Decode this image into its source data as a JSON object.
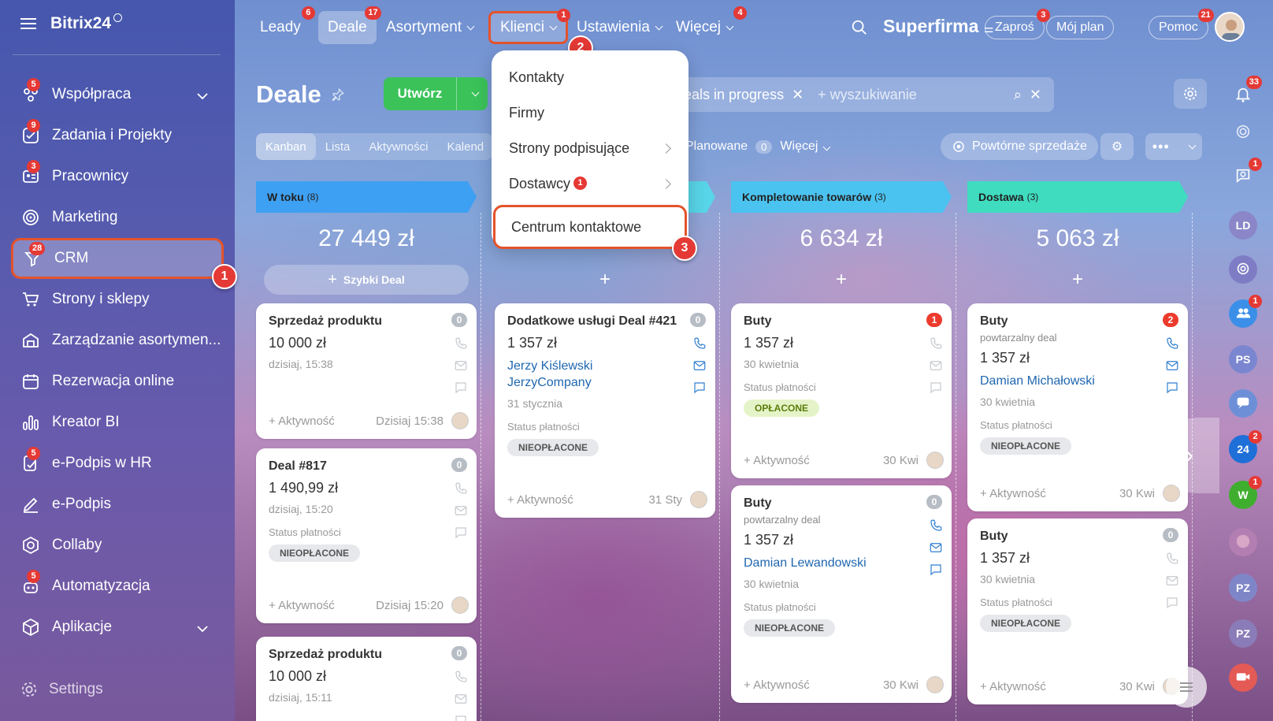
{
  "brand": {
    "name": "Bitrix24"
  },
  "sidebar": {
    "items": [
      {
        "label": "Współpraca",
        "badge": "5",
        "icon": "collab-icon",
        "chevron": true
      },
      {
        "label": "Zadania i Projekty",
        "badge": "9",
        "icon": "task-icon"
      },
      {
        "label": "Pracownicy",
        "badge": "3",
        "icon": "employees-icon"
      },
      {
        "label": "Marketing",
        "badge": "",
        "icon": "marketing-icon"
      },
      {
        "label": "CRM",
        "badge": "28",
        "icon": "crm-icon",
        "active": true,
        "step": "1"
      },
      {
        "label": "Strony i sklepy",
        "badge": "",
        "icon": "cart-icon"
      },
      {
        "label": "Zarządzanie asortymen...",
        "badge": "",
        "icon": "warehouse-icon"
      },
      {
        "label": "Rezerwacja online",
        "badge": "",
        "icon": "calendar-icon"
      },
      {
        "label": "Kreator BI",
        "badge": "",
        "icon": "bi-icon"
      },
      {
        "label": "e-Podpis w HR",
        "badge": "5",
        "icon": "hr-sign-icon"
      },
      {
        "label": "e-Podpis",
        "badge": "",
        "icon": "sign-icon"
      },
      {
        "label": "Collaby",
        "badge": "",
        "icon": "collaby-icon"
      },
      {
        "label": "Automatyzacja",
        "badge": "5",
        "icon": "robot-icon"
      },
      {
        "label": "Aplikacje",
        "badge": "",
        "icon": "apps-icon",
        "chevron": true
      }
    ],
    "settings_label": "Settings"
  },
  "topbar": {
    "tabs": [
      {
        "label": "Leady",
        "badge": "6"
      },
      {
        "label": "Deale",
        "badge": "17",
        "active": true
      },
      {
        "label": "Asortyment",
        "badge": "",
        "caret": true
      },
      {
        "label": "Klienci",
        "badge": "1",
        "caret": true,
        "step": "2"
      },
      {
        "label": "Ustawienia",
        "badge": "",
        "caret": true
      },
      {
        "label": "Więcej",
        "badge": "4",
        "caret": true
      }
    ],
    "company": "Superfirma",
    "invite": {
      "label": "Zaproś",
      "badge": "3"
    },
    "plan": {
      "label": "Mój plan"
    },
    "help": {
      "label": "Pomoc",
      "badge": "21"
    }
  },
  "dropdown": {
    "items": [
      {
        "label": "Kontakty"
      },
      {
        "label": "Firmy"
      },
      {
        "label": "Strony podpisujące",
        "arrow": true
      },
      {
        "label": "Dostawcy",
        "badge": "1",
        "arrow": true
      },
      {
        "label": "Centrum kontaktowe",
        "highlight": true,
        "step": "3"
      }
    ]
  },
  "page": {
    "title": "Deale",
    "create_label": "Utwórz",
    "filter_chip": "eals in progress",
    "search_placeholder": "+ wyszukiwanie",
    "views": [
      "Kanban",
      "Lista",
      "Aktywności",
      "Kalend"
    ],
    "planned_label": "Planowane",
    "planned_count": "0",
    "more_label": "Więcej",
    "repeat_sales": "Powtórne sprzedaże"
  },
  "columns": [
    {
      "title": "W toku",
      "count": "(8)",
      "total": "27 449 zł",
      "color": "#3ea0f2",
      "quick": "Szybki Deal",
      "cards": [
        {
          "title": "Sprzedaż produktu",
          "amount": "10 000 zł",
          "date": "dzisiaj, 15:38",
          "counter": "0",
          "activity": "+ Aktywność",
          "foot_date": "Dzisiaj 15:38"
        },
        {
          "title": "Deal #817",
          "amount": "1 490,99 zł",
          "date": "dzisiaj, 15:20",
          "counter": "0",
          "status_label": "Status płatności",
          "status": "NIEOPŁACONE",
          "activity": "+ Aktywność",
          "foot_date": "Dzisiaj 15:20"
        },
        {
          "title": "Sprzedaż produktu",
          "amount": "10 000 zł",
          "date": "dzisiaj, 15:11",
          "counter": "0"
        }
      ]
    },
    {
      "title": "",
      "count": "",
      "total": "",
      "color": "#58d5e8",
      "cards": [
        {
          "title": "Dodatkowe usługi Deal #421",
          "amount": "1 357 zł",
          "contact": "Jerzy Kiślewski",
          "company": "JerzyCompany",
          "date": "31 stycznia",
          "counter": "0",
          "status_label": "Status płatności",
          "status": "NIEOPŁACONE",
          "activity": "+ Aktywność",
          "foot_date": "31 Sty"
        }
      ]
    },
    {
      "title": "Kompletowanie towarów",
      "count": "(3)",
      "total": "6 634 zł",
      "color": "#4bc3f0",
      "cards": [
        {
          "title": "Buty",
          "amount": "1 357 zł",
          "date": "30 kwietnia",
          "counter": "1",
          "status_label": "Status płatności",
          "status": "OPŁACONE",
          "paid": true,
          "activity": "+ Aktywność",
          "foot_date": "30 Kwi"
        },
        {
          "title": "Buty",
          "subtitle": "powtarzalny deal",
          "amount": "1 357 zł",
          "contact": "Damian Lewandowski",
          "date": "30 kwietnia",
          "counter": "0",
          "status_label": "Status płatności",
          "status": "NIEOPŁACONE",
          "activity": "+ Aktywność",
          "foot_date": "30 Kwi"
        }
      ]
    },
    {
      "title": "Dostawa",
      "count": "(3)",
      "total": "5 063 zł",
      "color": "#3fdcc0",
      "cards": [
        {
          "title": "Buty",
          "subtitle": "powtarzalny deal",
          "amount": "1 357 zł",
          "contact": "Damian Michałowski",
          "date": "30 kwietnia",
          "counter": "2",
          "status_label": "Status płatności",
          "status": "NIEOPŁACONE",
          "activity": "+ Aktywność",
          "foot_date": "30 Kwi"
        },
        {
          "title": "Buty",
          "amount": "1 357 zł",
          "date": "30 kwietnia",
          "counter": "0",
          "status_label": "Status płatności",
          "status": "NIEOPŁACONE",
          "activity": "+ Aktywność",
          "foot_date": "30 Kwi"
        }
      ]
    }
  ],
  "right_panel": {
    "bell_badge": "33",
    "items": [
      {
        "type": "icon",
        "icon": "target-icon"
      },
      {
        "type": "icon",
        "icon": "chat-search-icon",
        "badge": "1"
      },
      {
        "type": "text",
        "text": "LD",
        "color": "#8a86c8"
      },
      {
        "type": "icon",
        "icon": "spiral-icon",
        "color": "#7f7cc6"
      },
      {
        "type": "icon",
        "icon": "group-icon",
        "badge": "1",
        "color": "#3b8fe8"
      },
      {
        "type": "text",
        "text": "PS",
        "color": "#7b86d0"
      },
      {
        "type": "icon",
        "icon": "message-icon",
        "color": "#6d8fd8"
      },
      {
        "type": "text",
        "text": "24",
        "badge": "2",
        "color": "#1f6fd8"
      },
      {
        "type": "text",
        "text": "W",
        "badge": "1",
        "color": "#3fae2e"
      },
      {
        "type": "icon",
        "icon": "photo-icon",
        "color": "#b37fb2"
      },
      {
        "type": "text",
        "text": "PZ",
        "color": "#7f86c8"
      },
      {
        "type": "text",
        "text": "PZ",
        "color": "#8a7cb8"
      },
      {
        "type": "icon",
        "icon": "video-icon",
        "color": "#e45a55"
      }
    ]
  }
}
